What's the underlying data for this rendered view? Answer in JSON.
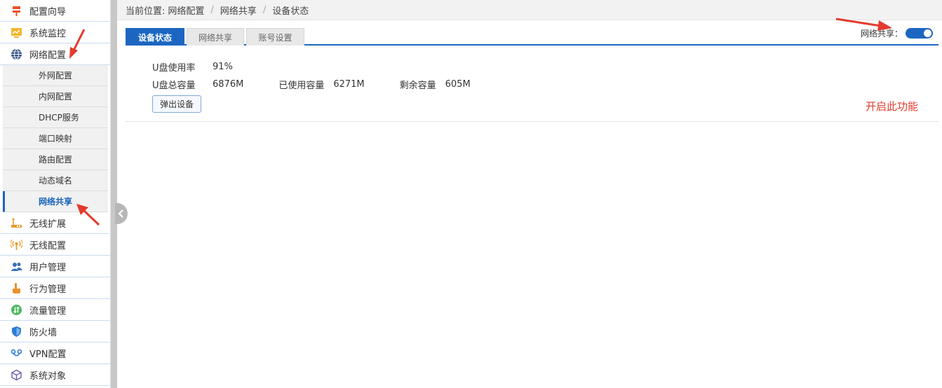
{
  "sidebar": {
    "items": [
      {
        "label": "配置向导",
        "icon": "wizard-icon"
      },
      {
        "label": "系统监控",
        "icon": "monitor-icon"
      },
      {
        "label": "网络配置",
        "icon": "network-globe-icon"
      }
    ],
    "subitems": [
      {
        "label": "外网配置"
      },
      {
        "label": "内网配置"
      },
      {
        "label": "DHCP服务"
      },
      {
        "label": "端口映射"
      },
      {
        "label": "路由配置"
      },
      {
        "label": "动态域名"
      },
      {
        "label": "网络共享"
      }
    ],
    "items_after": [
      {
        "label": "无线扩展",
        "icon": "wireless-extend-icon"
      },
      {
        "label": "无线配置",
        "icon": "wireless-signal-icon"
      },
      {
        "label": "用户管理",
        "icon": "users-icon"
      },
      {
        "label": "行为管理",
        "icon": "hand-pointer-icon"
      },
      {
        "label": "流量管理",
        "icon": "traffic-icon"
      },
      {
        "label": "防火墙",
        "icon": "shield-icon"
      },
      {
        "label": "VPN配置",
        "icon": "vpn-icon"
      },
      {
        "label": "系统对象",
        "icon": "cube-icon"
      }
    ]
  },
  "breadcrumb": {
    "prefix": "当前位置:",
    "level1": "网络配置",
    "level2": "网络共享",
    "level3": "设备状态"
  },
  "tabs": [
    {
      "label": "设备状态"
    },
    {
      "label": "网络共享"
    },
    {
      "label": "账号设置"
    }
  ],
  "share_toggle": {
    "label": "网络共享：",
    "enabled": true
  },
  "device": {
    "usage_label": "U盘使用率",
    "usage_value": "91%",
    "total_label": "U盘总容量",
    "total_value": "6876M",
    "used_label": "已使用容量",
    "used_value": "6271M",
    "free_label": "剩余容量",
    "free_value": "605M",
    "eject_label": "弹出设备"
  },
  "annotation": {
    "note": "开启此功能",
    "color": "#e23b2e"
  },
  "colors": {
    "accent": "#1c66c2"
  }
}
